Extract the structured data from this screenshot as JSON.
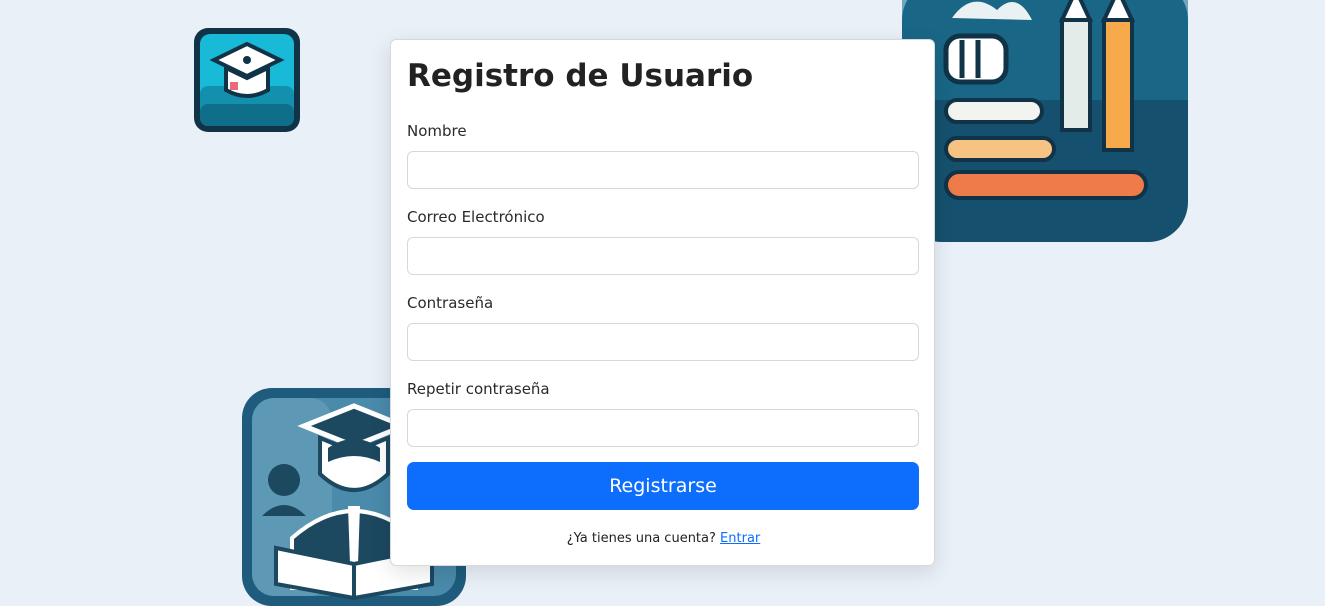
{
  "form": {
    "title": "Registro de Usuario",
    "fields": [
      {
        "label": "Nombre",
        "value": "",
        "placeholder": ""
      },
      {
        "label": "Correo Electrónico",
        "value": "",
        "placeholder": ""
      },
      {
        "label": "Contraseña",
        "value": "",
        "placeholder": ""
      },
      {
        "label": "Repetir contraseña",
        "value": "",
        "placeholder": ""
      }
    ],
    "submit_label": "Registrarse",
    "footer_prompt": "¿Ya tienes una cuenta?",
    "footer_link": "Entrar"
  },
  "colors": {
    "background": "#eaf0f8",
    "primary": "#0d6efd",
    "tile_teal": "#1aa6c4",
    "tile_dark": "#123a4e"
  },
  "decorations": {
    "top_left": "graduation-cap-app-icon",
    "top_right": "books-pencils-app-icon",
    "bottom_left": "graduate-student-app-icon"
  }
}
